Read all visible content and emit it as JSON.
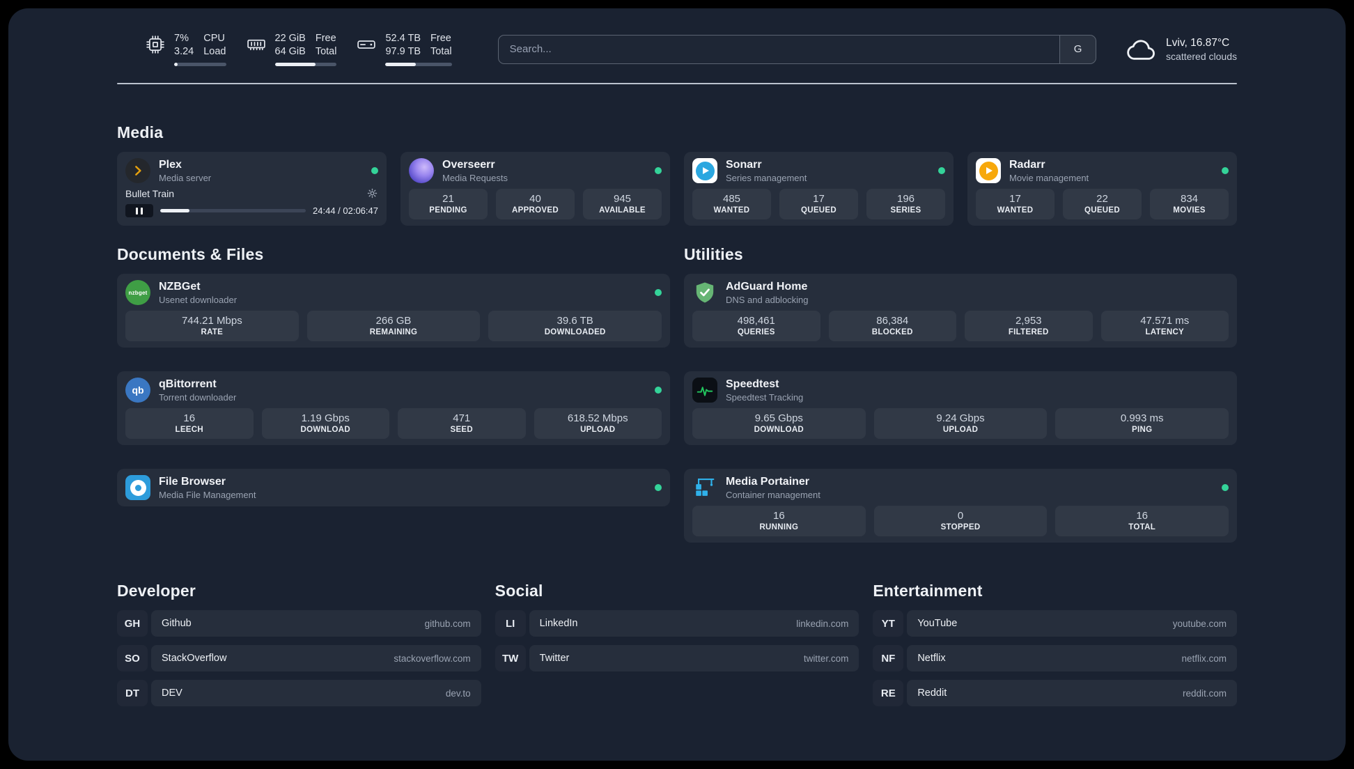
{
  "colors": {
    "status_dot_green": "#34d399",
    "speedtest_line_green": "#22c55e",
    "plex_gold": "#e5a00d"
  },
  "topbar": {
    "cpu": {
      "icon": "cpu-icon",
      "value_top": "7%",
      "value_bottom": "3.24",
      "label_top": "CPU",
      "label_bottom": "Load",
      "usage_percent": 7
    },
    "memory": {
      "icon": "memory-icon",
      "value_top": "22 GiB",
      "value_bottom": "64 GiB",
      "label_top": "Free",
      "label_bottom": "Total",
      "usage_percent": 66
    },
    "disk": {
      "icon": "disk-icon",
      "value_top": "52.4 TB",
      "value_bottom": "97.9 TB",
      "label_top": "Free",
      "label_bottom": "Total",
      "usage_percent": 46
    },
    "search": {
      "placeholder": "Search...",
      "provider_label": "G"
    },
    "weather": {
      "icon": "cloud-icon",
      "location": "Lviv, 16.87°C",
      "condition": "scattered clouds"
    }
  },
  "media": {
    "title": "Media",
    "cards": [
      {
        "name": "Plex",
        "subtitle": "Media server",
        "icon": "plex-icon",
        "status_dot": true,
        "player": {
          "track_title": "Bullet Train",
          "time": "24:44 / 02:06:47",
          "progress_percent": 20
        }
      },
      {
        "name": "Overseerr",
        "subtitle": "Media Requests",
        "icon": "overseerr-icon",
        "status_dot": true,
        "stats": [
          {
            "value": "21",
            "label": "PENDING"
          },
          {
            "value": "40",
            "label": "APPROVED"
          },
          {
            "value": "945",
            "label": "AVAILABLE"
          }
        ]
      },
      {
        "name": "Sonarr",
        "subtitle": "Series management",
        "icon": "sonarr-icon",
        "status_dot": true,
        "stats": [
          {
            "value": "485",
            "label": "WANTED"
          },
          {
            "value": "17",
            "label": "QUEUED"
          },
          {
            "value": "196",
            "label": "SERIES"
          }
        ]
      },
      {
        "name": "Radarr",
        "subtitle": "Movie management",
        "icon": "radarr-icon",
        "status_dot": true,
        "stats": [
          {
            "value": "17",
            "label": "WANTED"
          },
          {
            "value": "22",
            "label": "QUEUED"
          },
          {
            "value": "834",
            "label": "MOVIES"
          }
        ]
      }
    ]
  },
  "documents": {
    "title": "Documents & Files",
    "cards": [
      {
        "name": "NZBGet",
        "subtitle": "Usenet downloader",
        "icon": "nzbget-icon",
        "status_dot": true,
        "stats": [
          {
            "value": "744.21 Mbps",
            "label": "RATE"
          },
          {
            "value": "266 GB",
            "label": "REMAINING"
          },
          {
            "value": "39.6 TB",
            "label": "DOWNLOADED"
          }
        ]
      },
      {
        "name": "qBittorrent",
        "subtitle": "Torrent downloader",
        "icon": "qbittorrent-icon",
        "status_dot": true,
        "stats": [
          {
            "value": "16",
            "label": "LEECH"
          },
          {
            "value": "1.19 Gbps",
            "label": "DOWNLOAD"
          },
          {
            "value": "471",
            "label": "SEED"
          },
          {
            "value": "618.52 Mbps",
            "label": "UPLOAD"
          }
        ]
      },
      {
        "name": "File Browser",
        "subtitle": "Media File Management",
        "icon": "filebrowser-icon",
        "status_dot": true
      }
    ]
  },
  "utilities": {
    "title": "Utilities",
    "cards": [
      {
        "name": "AdGuard Home",
        "subtitle": "DNS and adblocking",
        "icon": "adguard-icon",
        "status_dot": false,
        "stats": [
          {
            "value": "498,461",
            "label": "QUERIES"
          },
          {
            "value": "86,384",
            "label": "BLOCKED"
          },
          {
            "value": "2,953",
            "label": "FILTERED"
          },
          {
            "value": "47.571 ms",
            "label": "LATENCY"
          }
        ]
      },
      {
        "name": "Speedtest",
        "subtitle": "Speedtest Tracking",
        "icon": "speedtest-icon",
        "status_dot": false,
        "stats": [
          {
            "value": "9.65 Gbps",
            "label": "DOWNLOAD"
          },
          {
            "value": "9.24 Gbps",
            "label": "UPLOAD"
          },
          {
            "value": "0.993 ms",
            "label": "PING"
          }
        ]
      },
      {
        "name": "Media Portainer",
        "subtitle": "Container management",
        "icon": "portainer-icon",
        "status_dot": true,
        "stats": [
          {
            "value": "16",
            "label": "RUNNING"
          },
          {
            "value": "0",
            "label": "STOPPED"
          },
          {
            "value": "16",
            "label": "TOTAL"
          }
        ]
      }
    ]
  },
  "bookmarks": [
    {
      "title": "Developer",
      "items": [
        {
          "abbr": "GH",
          "name": "Github",
          "url": "github.com"
        },
        {
          "abbr": "SO",
          "name": "StackOverflow",
          "url": "stackoverflow.com"
        },
        {
          "abbr": "DT",
          "name": "DEV",
          "url": "dev.to"
        }
      ]
    },
    {
      "title": "Social",
      "items": [
        {
          "abbr": "LI",
          "name": "LinkedIn",
          "url": "linkedin.com"
        },
        {
          "abbr": "TW",
          "name": "Twitter",
          "url": "twitter.com"
        }
      ]
    },
    {
      "title": "Entertainment",
      "items": [
        {
          "abbr": "YT",
          "name": "YouTube",
          "url": "youtube.com"
        },
        {
          "abbr": "NF",
          "name": "Netflix",
          "url": "netflix.com"
        },
        {
          "abbr": "RE",
          "name": "Reddit",
          "url": "reddit.com"
        }
      ]
    }
  ]
}
